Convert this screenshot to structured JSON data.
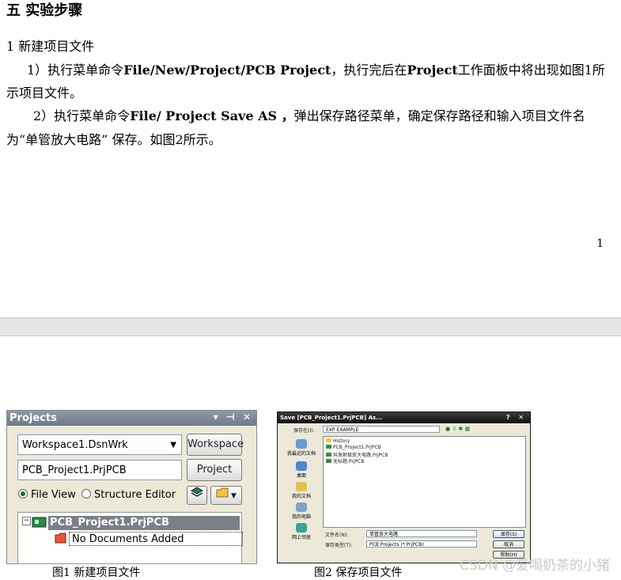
{
  "heading": "五  实验步骤",
  "step_title": "1  新建项目文件",
  "para1": {
    "a": "1）执行菜单命令",
    "cmd": "File/New/Project/PCB    Project",
    "b": "，执行完后在",
    "panel": "Project",
    "c": "工作面板中将出现如图1所",
    "cont": "示项目文件。"
  },
  "para2": {
    "a": "2）执行菜单命令",
    "cmd": "File/ Project Save AS  ，",
    "b": "弹出保存路径菜单，确定保存路径和输入项目文件名",
    "cont": "为“单管放大电路”  保存。如图2所示。"
  },
  "page_number": "1",
  "figure1": {
    "panel_title": "Projects",
    "title_icons": "▾ ⊣ ✕",
    "workspace_value": "Workspace1.DsnWrk",
    "workspace_button": "Workspace",
    "project_value": "PCB_Project1.PrjPCB",
    "project_button": "Project",
    "radio_file_view": "File View",
    "radio_structure": "Structure Editor",
    "tree_node": "PCB_Project1.PrjPCB",
    "tree_leaf": "No Documents Added",
    "selected_view": "File View"
  },
  "figure2": {
    "title": "Save [PCB_Project1.PrjPCB] As...",
    "title_controls": "? ✕",
    "save_in_label": "保存在(I):",
    "save_in_value": "EXP EXAMPLE",
    "files": [
      "History",
      "PCB_Project1.PrjPCB",
      "共发射极放大电路.PrjPCB",
      "无标题.PrjPCB"
    ],
    "places": [
      "我最近的文档",
      "桌面",
      "我的文档",
      "我的电脑",
      "网上邻居"
    ],
    "filename_label": "文件名(N):",
    "filename_value": "单管放大电路",
    "filetype_label": "保存类型(T):",
    "filetype_value": "PCB Projects (*.PrjPCB)",
    "btn_save": "保存(S)",
    "btn_cancel": "取消",
    "btn_help": "帮助(H)"
  },
  "caption1": "图1  新建项目文件",
  "caption2": "图2  保存项目文件",
  "watermark": "CSDN @爱喝奶茶的小猪"
}
